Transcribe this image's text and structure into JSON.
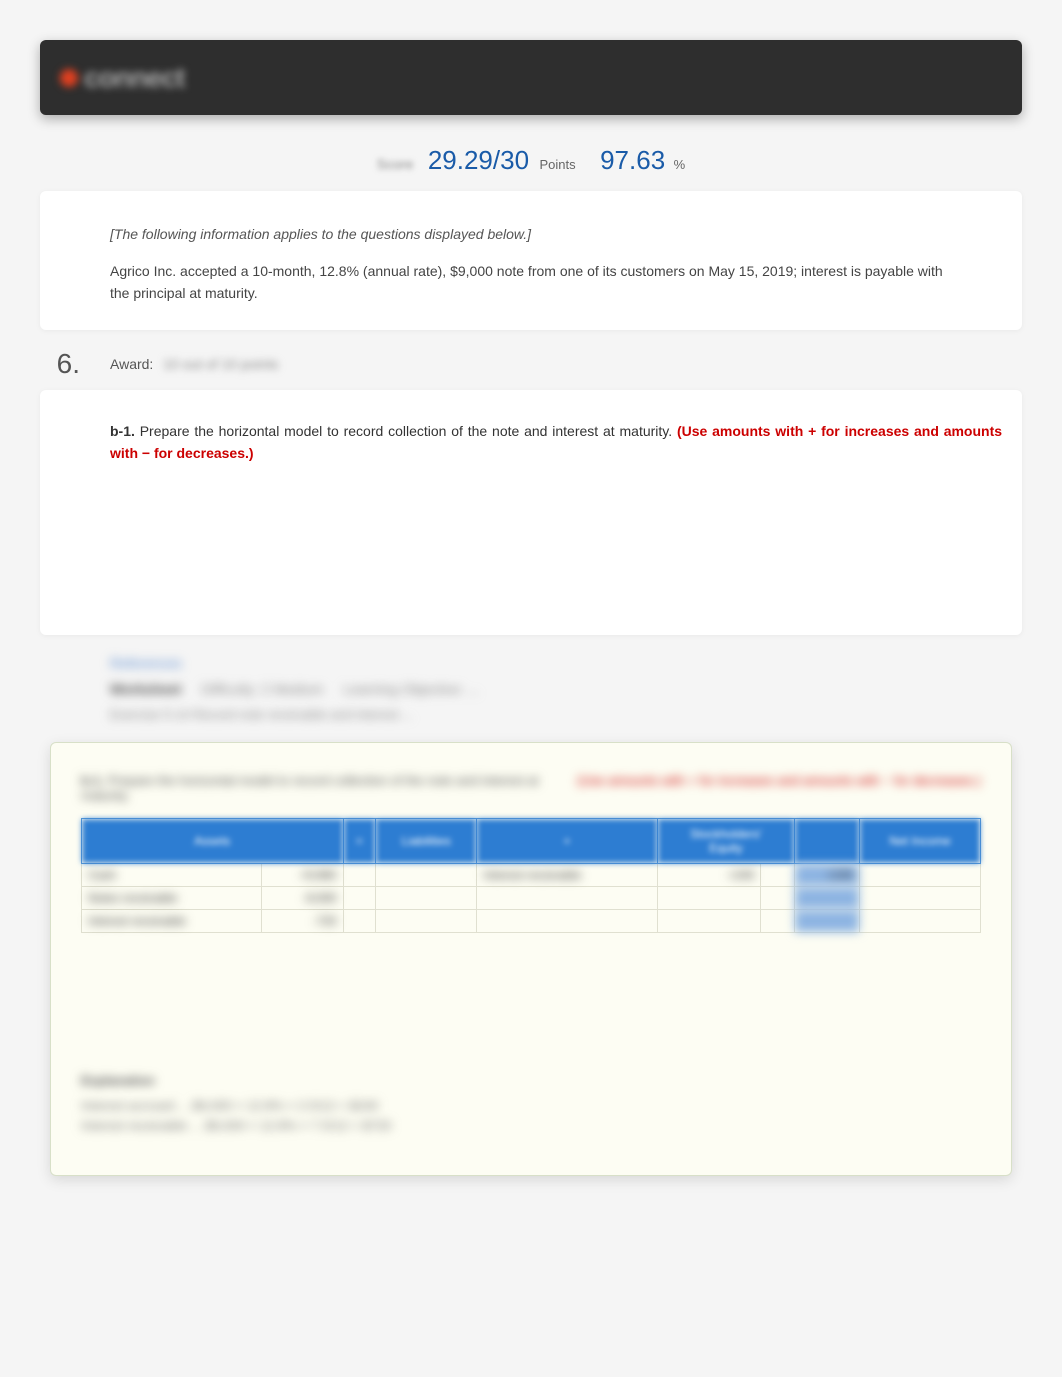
{
  "header": {
    "logo_text": "connect"
  },
  "score": {
    "label": "Score",
    "points_value": "29.29/30",
    "points_label": "Points",
    "percent_value": "97.63",
    "percent_symbol": "%"
  },
  "scenario": {
    "note": "[The following information applies to the questions displayed below.]",
    "text": "Agrico Inc. accepted a 10-month, 12.8% (annual rate), $9,000 note from one of its customers on May 15, 2019; interest is payable with the principal at maturity."
  },
  "question": {
    "number": "6.",
    "award_label": "Award:",
    "award_value": "10 out of 10 points",
    "part": "b-1.",
    "body": "Prepare  the  horizontal  model  to  record  collection  of  the  note  and  interest  at  maturity.",
    "hint": "(Use amounts with + for increases and amounts with − for decreases.)"
  },
  "blur_meta": {
    "ref": "References",
    "worksheet": "Worksheet",
    "difficulty": "Difficulty: 2 Medium",
    "lo": "Learning Objective: ...",
    "sub": "Exercise 5-14 Record note receivable and interest ..."
  },
  "answer_box": {
    "header_left_bold": "b-1.",
    "header_left_text": "Prepare the horizontal model to record collection of the note and interest at maturity.",
    "header_right": "(Use amounts with + for increases and amounts with − for decreases.)",
    "table": {
      "headers": [
        "Assets",
        "=",
        "Liabilities",
        "+",
        "Stockholders' Equity",
        " ",
        "Net Income"
      ],
      "stacked_header_top": "Stockholders'",
      "stacked_header_bot": "Equity",
      "rows": [
        {
          "c0": "Cash",
          "c1": "+9,960",
          "c2": "",
          "c3": "",
          "c4": "Interest receivable",
          "c5": "+240",
          "c6": "",
          "c7": "+240",
          "c8": ""
        },
        {
          "c0": "Notes receivable",
          "c1": "-9,000",
          "c2": "",
          "c3": "",
          "c4": "",
          "c5": "",
          "c6": "",
          "c7": "",
          "c8": ""
        },
        {
          "c0": "Interest receivable",
          "c1": "-720",
          "c2": "",
          "c3": "",
          "c4": "",
          "c5": "",
          "c6": "",
          "c7": "",
          "c8": ""
        }
      ]
    },
    "explanation_title": "Explanation",
    "explanation_line1": "Interest accrued ... $9,000 × 12.8% × 2.5/12 = $240",
    "explanation_line2": "Interest receivable ... $9,000 × 12.8% × 7.5/12 = $720"
  }
}
